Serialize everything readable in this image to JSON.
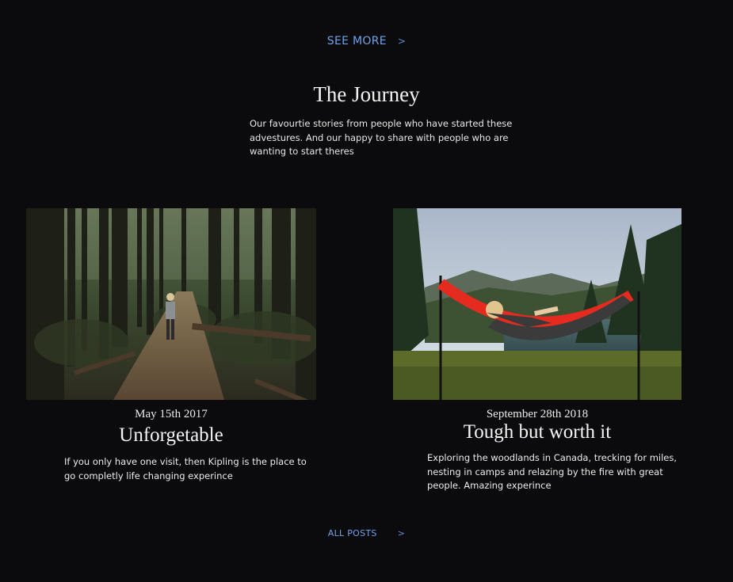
{
  "header": {
    "see_more_label": "SEE MORE",
    "see_more_icon": "chevron-right-icon"
  },
  "journey": {
    "title": "The Journey",
    "description": "Our favourtie stories from people who have started these advestures. And our happy to share with people who are wanting to start theres"
  },
  "posts": [
    {
      "image": "forest-trail-hiker-photo",
      "date": "May 15th 2017",
      "title": "Unforgetable",
      "excerpt": "If you only have one visit, then Kipling is the place to go completly life changing experince"
    },
    {
      "image": "hammock-lake-photo",
      "date": "September 28th 2018",
      "title": "Tough but worth it",
      "excerpt": "Exploring the woodlands in Canada, trecking for miles, nesting in camps and relazing by the fire with great people. Amazing experince"
    }
  ],
  "footer": {
    "all_posts_label": "ALL POSTS",
    "all_posts_icon": "chevron-right-icon"
  },
  "colors": {
    "background": "#0b0a0c",
    "link": "#6fa3ec",
    "text": "#ececec"
  }
}
